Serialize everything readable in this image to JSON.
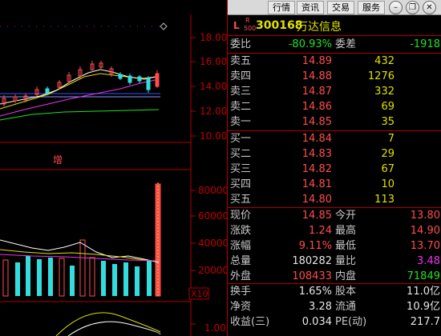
{
  "toolbar": {
    "tab_quotes": "行情",
    "tab_info": "资讯",
    "tab_trade": "交易",
    "tab_service": "服务"
  },
  "stock": {
    "mark": "L",
    "mark_sup": "R",
    "mark_sub": "500",
    "code": "300168",
    "name": "万达信息"
  },
  "chart": {
    "price_axis": [
      "18.00",
      "16.00",
      "14.00",
      "12.00",
      "10.00"
    ],
    "volume_axis": [
      "80000",
      "60000",
      "40000",
      "20000"
    ],
    "volume_unit": "X10",
    "indicator_axis": "1.00",
    "marker": "增"
  },
  "quote": {
    "weibi": {
      "label": "委比",
      "value": "-80.93%"
    },
    "weicha": {
      "label": "委差",
      "value": "-1918"
    },
    "sell": [
      {
        "label": "卖五",
        "price": "14.89",
        "vol": "432"
      },
      {
        "label": "卖四",
        "price": "14.88",
        "vol": "1276"
      },
      {
        "label": "卖三",
        "price": "14.87",
        "vol": "332"
      },
      {
        "label": "卖二",
        "price": "14.86",
        "vol": "69"
      },
      {
        "label": "卖一",
        "price": "14.85",
        "vol": "35"
      }
    ],
    "buy": [
      {
        "label": "买一",
        "price": "14.84",
        "vol": "7"
      },
      {
        "label": "买二",
        "price": "14.83",
        "vol": "29"
      },
      {
        "label": "买三",
        "price": "14.82",
        "vol": "67"
      },
      {
        "label": "买四",
        "price": "14.81",
        "vol": "10"
      },
      {
        "label": "买五",
        "price": "14.80",
        "vol": "113"
      }
    ],
    "stats": [
      {
        "l1": "现价",
        "v1": "14.85",
        "l2": "今开",
        "v2": "13.80"
      },
      {
        "l1": "涨跌",
        "v1": "1.24",
        "l2": "最高",
        "v2": "14.90"
      },
      {
        "l1": "涨幅",
        "v1": "9.11%",
        "l2": "最低",
        "v2": "13.70"
      },
      {
        "l1": "总量",
        "v1": "180282",
        "l2": "量比",
        "v2": "3.48"
      },
      {
        "l1": "外盘",
        "v1": "108433",
        "l2": "内盘",
        "v2": "71849"
      }
    ],
    "stats2": [
      {
        "l1": "换手",
        "v1": "1.65%",
        "l2": "股本",
        "v2": "11.0亿"
      },
      {
        "l1": "净资",
        "v1": "3.28",
        "l2": "流通",
        "v2": "10.9亿"
      },
      {
        "l1": "收益(三)",
        "v1": "0.034",
        "l2": "PE(动)",
        "v2": "217.7"
      }
    ]
  },
  "colors": {
    "up": "#ff4c4c",
    "down": "#22e022",
    "volume": "#e0e000",
    "border": "#b00000",
    "ma5": "#ffffff",
    "ma10": "#e0e000",
    "ma20": "#ee33ee",
    "ma60": "#22e022"
  }
}
